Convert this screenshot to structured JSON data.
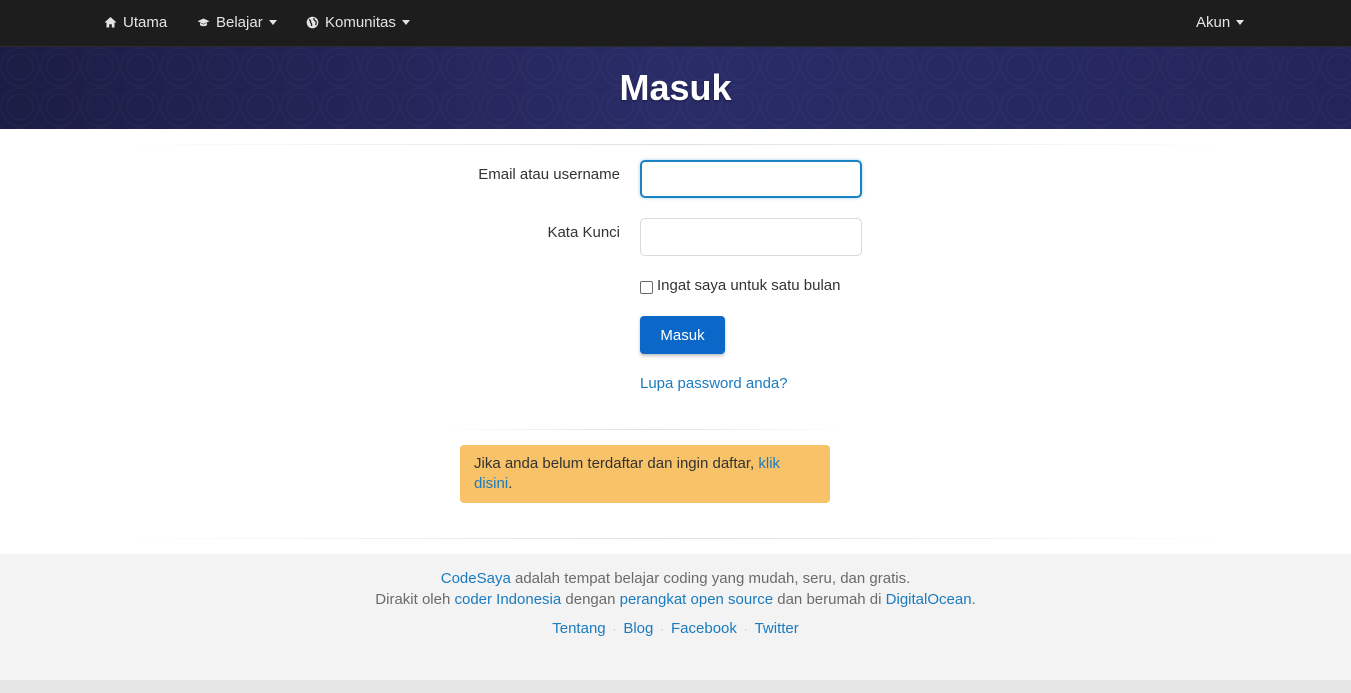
{
  "navbar": {
    "items": [
      {
        "label": "Utama",
        "icon": "home-icon"
      },
      {
        "label": "Belajar",
        "icon": "graduation-cap-icon"
      },
      {
        "label": "Komunitas",
        "icon": "globe-icon"
      }
    ],
    "account_label": "Akun"
  },
  "hero": {
    "title": "Masuk"
  },
  "form": {
    "email_label": "Email atau username",
    "email_value": "",
    "password_label": "Kata Kunci",
    "password_value": "",
    "remember_label": "Ingat saya untuk satu bulan",
    "remember_checked": false,
    "submit_label": "Masuk",
    "forgot_link": "Lupa password anda?"
  },
  "register_alert": {
    "text": "Jika anda belum terdaftar dan ingin daftar, ",
    "link_text": "klik disini",
    "suffix": "."
  },
  "footer": {
    "line1": {
      "brand": "CodeSaya",
      "text": " adalah tempat belajar coding yang mudah, seru, dan gratis."
    },
    "line2": {
      "prefix": "Dirakit oleh ",
      "link1": "coder Indonesia",
      "mid1": " dengan ",
      "link2": "perangkat open source",
      "mid2": " dan berumah di ",
      "link3": "DigitalOcean",
      "suffix": "."
    },
    "links": [
      "Tentang",
      "Blog",
      "Facebook",
      "Twitter"
    ],
    "separator": "·"
  },
  "colors": {
    "navbar_bg": "#1d1d1d",
    "hero_bg": "#242659",
    "primary_button": "#0b67c8",
    "link": "#1a7bbf",
    "alert_bg": "#f8c268",
    "footer_bg": "#f3f3f3"
  }
}
